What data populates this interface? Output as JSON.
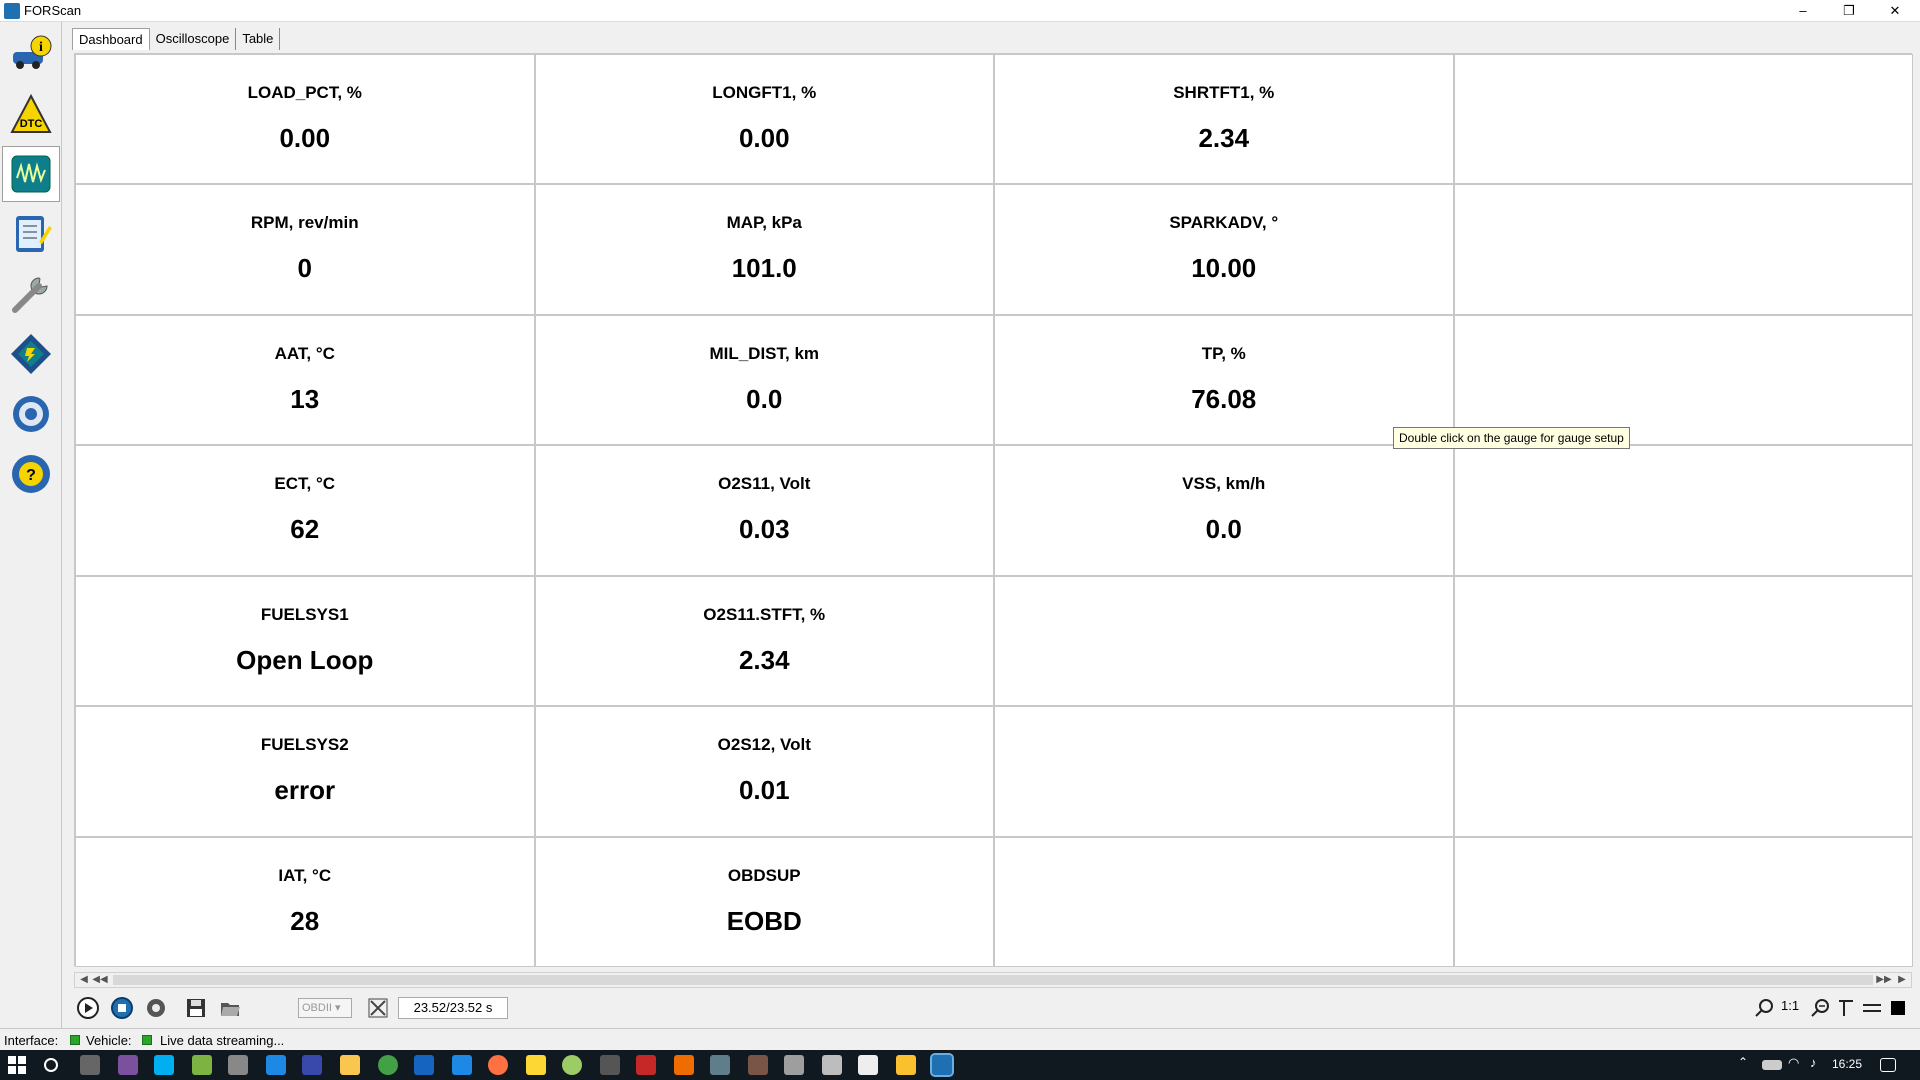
{
  "window": {
    "title": "FORScan",
    "minimize": "–",
    "maximize": "❐",
    "close": "✕"
  },
  "tabs": [
    {
      "label": "Dashboard"
    },
    {
      "label": "Oscilloscope"
    },
    {
      "label": "Table"
    }
  ],
  "sidebar": {
    "items": [
      {
        "icon": "vehicle-info-icon"
      },
      {
        "icon": "dtc-warning-icon"
      },
      {
        "icon": "oscilloscope-icon"
      },
      {
        "icon": "checklist-icon"
      },
      {
        "icon": "wrench-icon"
      },
      {
        "icon": "module-programming-icon"
      },
      {
        "icon": "settings-gear-icon"
      },
      {
        "icon": "help-icon"
      }
    ]
  },
  "gauges": [
    {
      "label": "LOAD_PCT, %",
      "value": "0.00"
    },
    {
      "label": "LONGFT1, %",
      "value": "0.00"
    },
    {
      "label": "SHRTFT1, %",
      "value": "2.34"
    },
    {
      "label": "RPM, rev/min",
      "value": "0"
    },
    {
      "label": "MAP, kPa",
      "value": "101.0"
    },
    {
      "label": "SPARKADV, °",
      "value": "10.00"
    },
    {
      "label": "AAT, °C",
      "value": "13"
    },
    {
      "label": "MIL_DIST, km",
      "value": "0.0"
    },
    {
      "label": "TP, %",
      "value": "76.08"
    },
    {
      "label": "ECT, °C",
      "value": "62"
    },
    {
      "label": "O2S11, Volt",
      "value": "0.03"
    },
    {
      "label": "VSS, km/h",
      "value": "0.0"
    },
    {
      "label": "FUELSYS1",
      "value": "Open Loop"
    },
    {
      "label": "O2S11.STFT, %",
      "value": "2.34"
    },
    {
      "label": "FUELSYS2",
      "value": "error"
    },
    {
      "label": "O2S12, Volt",
      "value": "0.01"
    },
    {
      "label": "IAT, °C",
      "value": "28"
    },
    {
      "label": "OBDSUP",
      "value": "EOBD"
    }
  ],
  "tooltip": "Double click on the gauge for gauge setup",
  "toolbar": {
    "obd_select": "OBDII",
    "time": "23.52/23.52 s",
    "zoom_ratio": "1:1"
  },
  "status": {
    "interface_label": "Interface:",
    "vehicle_label": "Vehicle:",
    "message": "Live data streaming..."
  },
  "taskbar": {
    "clock": "16:25"
  },
  "colors": {
    "led_green": "#2aa52a",
    "accent_blue": "#1f6fb3",
    "tooltip_bg": "#ffffe1"
  }
}
